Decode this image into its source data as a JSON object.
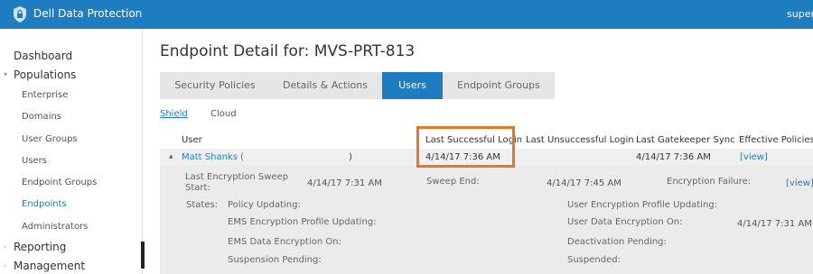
{
  "topbar": {
    "app_title": "Dell Data Protection",
    "user": "super",
    "logo_icon": "shield-lock-icon"
  },
  "sidebar": {
    "dashboard": "Dashboard",
    "populations": "Populations",
    "enterprise": "Enterprise",
    "domains": "Domains",
    "user_groups": "User Groups",
    "users": "Users",
    "endpoint_groups": "Endpoint Groups",
    "endpoints": "Endpoints",
    "administrators": "Administrators",
    "reporting": "Reporting",
    "management": "Management",
    "active_item": "Endpoints"
  },
  "page": {
    "title": "Endpoint Detail for: MVS-PRT-813"
  },
  "tabs": [
    {
      "label": "Security Policies"
    },
    {
      "label": "Details & Actions"
    },
    {
      "label": "Users"
    },
    {
      "label": "Endpoint Groups"
    }
  ],
  "active_tab": "Users",
  "subtabs": [
    {
      "label": "Shield"
    },
    {
      "label": "Cloud"
    }
  ],
  "table": {
    "columns": {
      "user": "User",
      "last_successful": "Last Successful Login",
      "last_unsuccessful": "Last Unsuccessful Login",
      "last_gatekeeper": "Last Gatekeeper Sync",
      "effective_policies": "Effective Policies"
    },
    "row": {
      "user": "Matt Shanks (",
      "user_close": ")",
      "last_successful": "4/14/17 7:36 AM",
      "last_gatekeeper": "4/14/17 7:36 AM",
      "policies_link": "[view]"
    }
  },
  "detail": {
    "sweep_start_label_1": "Last Encryption Sweep",
    "sweep_start_label_2": "Start:",
    "sweep_start_value": "4/14/17 7:31 AM",
    "sweep_end_label": "Sweep End:",
    "sweep_end_value": "4/14/17 7:45 AM",
    "encryption_failure_label": "Encryption Failure:",
    "encryption_failure_link": "[view]",
    "states_label": "States:",
    "policy_updating": "Policy Updating:",
    "ems_profile_updating": "EMS Encryption Profile Updating:",
    "ems_data_encryption": "EMS Data Encryption On:",
    "suspension_pending": "Suspension Pending:",
    "user_profile_updating": "User Encryption Profile Updating:",
    "user_data_encryption": "User Data Encryption On:",
    "user_data_encryption_value": "4/14/17 7:31 AM",
    "deactivation_pending": "Deactivation Pending:",
    "suspended": "Suspended:"
  },
  "colors": {
    "brand": "#1e7dc0",
    "highlight": "#e87722"
  }
}
